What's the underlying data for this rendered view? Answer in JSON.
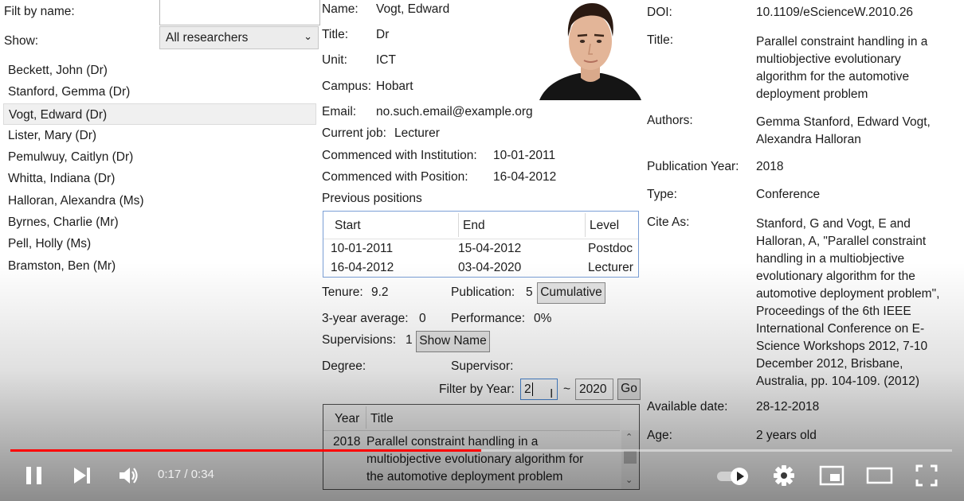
{
  "left": {
    "filter_label": "Filt by name:",
    "filter_value": "",
    "show_label": "Show:",
    "show_selected": "All researchers",
    "researchers": [
      "Beckett, John (Dr)",
      "Stanford, Gemma (Dr)",
      "Vogt, Edward (Dr)",
      "Lister, Mary (Dr)",
      "Pemulwuy, Caitlyn (Dr)",
      "Whitta, Indiana (Dr)",
      "Halloran, Alexandra (Ms)",
      "Byrnes, Charlie (Mr)",
      "Pell, Holly (Ms)",
      "Bramston, Ben (Mr)"
    ],
    "selected_index": 2
  },
  "details": {
    "name_label": "Name:",
    "name": "Vogt, Edward",
    "title_label": "Title:",
    "title": "Dr",
    "unit_label": "Unit:",
    "unit": "ICT",
    "campus_label": "Campus:",
    "campus": "Hobart",
    "email_label": "Email:",
    "email": "no.such.email@example.org",
    "current_job_label": "Current job:",
    "current_job": "Lecturer",
    "commenced_inst_label": "Commenced with Institution:",
    "commenced_inst": "10-01-2011",
    "commenced_pos_label": "Commenced with Position:",
    "commenced_pos": "16-04-2012",
    "prev_positions_label": "Previous positions",
    "positions_headers": [
      "Start",
      "End",
      "Level"
    ],
    "positions": [
      [
        "10-01-2011",
        "15-04-2012",
        "Postdoc"
      ],
      [
        "16-04-2012",
        "03-04-2020",
        "Lecturer"
      ]
    ],
    "tenure_label": "Tenure:",
    "tenure": "9.2",
    "publication_label": "Publication:",
    "publication": "5",
    "cumulative_btn": "Cumulative",
    "avg_label": "3-year average:",
    "avg": "0",
    "performance_label": "Performance:",
    "performance": "0%",
    "supervisions_label": "Supervisions:",
    "supervisions": "1",
    "show_name_btn": "Show Name",
    "degree_label": "Degree:",
    "supervisor_label": "Supervisor:",
    "filter_year_label": "Filter by Year:",
    "year_from": "2",
    "year_sep": "~",
    "year_to": "2020",
    "go_btn": "Go",
    "pub_headers": [
      "Year",
      "Title"
    ],
    "pubs": [
      {
        "year": "2018",
        "title_lines": [
          "Parallel constraint handling in a",
          "multiobjective evolutionary algorithm for",
          "the automotive deployment problem"
        ]
      }
    ]
  },
  "publication": {
    "doi_label": "DOI:",
    "doi": "10.1109/eScienceW.2010.26",
    "title_label": "Title:",
    "title_lines": [
      "Parallel constraint handling in a",
      "multiobjective evolutionary",
      "algorithm for the automotive",
      "deployment problem"
    ],
    "authors_label": "Authors:",
    "authors_lines": [
      "Gemma Stanford, Edward Vogt,",
      "Alexandra Halloran"
    ],
    "year_label": "Publication Year:",
    "year": "2018",
    "type_label": "Type:",
    "type": "Conference",
    "cite_label": "Cite As:",
    "cite_lines": [
      "Stanford, G and Vogt, E and",
      "Halloran, A, \"Parallel constraint",
      "handling in a multiobjective",
      "evolutionary algorithm for the",
      "automotive deployment problem\",",
      "Proceedings of the 6th IEEE",
      "International Conference on E-",
      "Science Workshops 2012, 7-10",
      "December 2012, Brisbane,",
      "Australia, pp. 104-109. (2012)"
    ],
    "available_label": "Available date:",
    "available": "28-12-2018",
    "age_label": "Age:",
    "age": "2 years old"
  },
  "player": {
    "time": "0:17 / 0:34",
    "progress": 0.5,
    "accent": "#ff0000",
    "icons": [
      "pause-icon",
      "next-icon",
      "volume-icon",
      "autoplay-toggle-icon",
      "settings-gear-icon",
      "miniplayer-icon",
      "theater-icon",
      "fullscreen-icon"
    ]
  }
}
